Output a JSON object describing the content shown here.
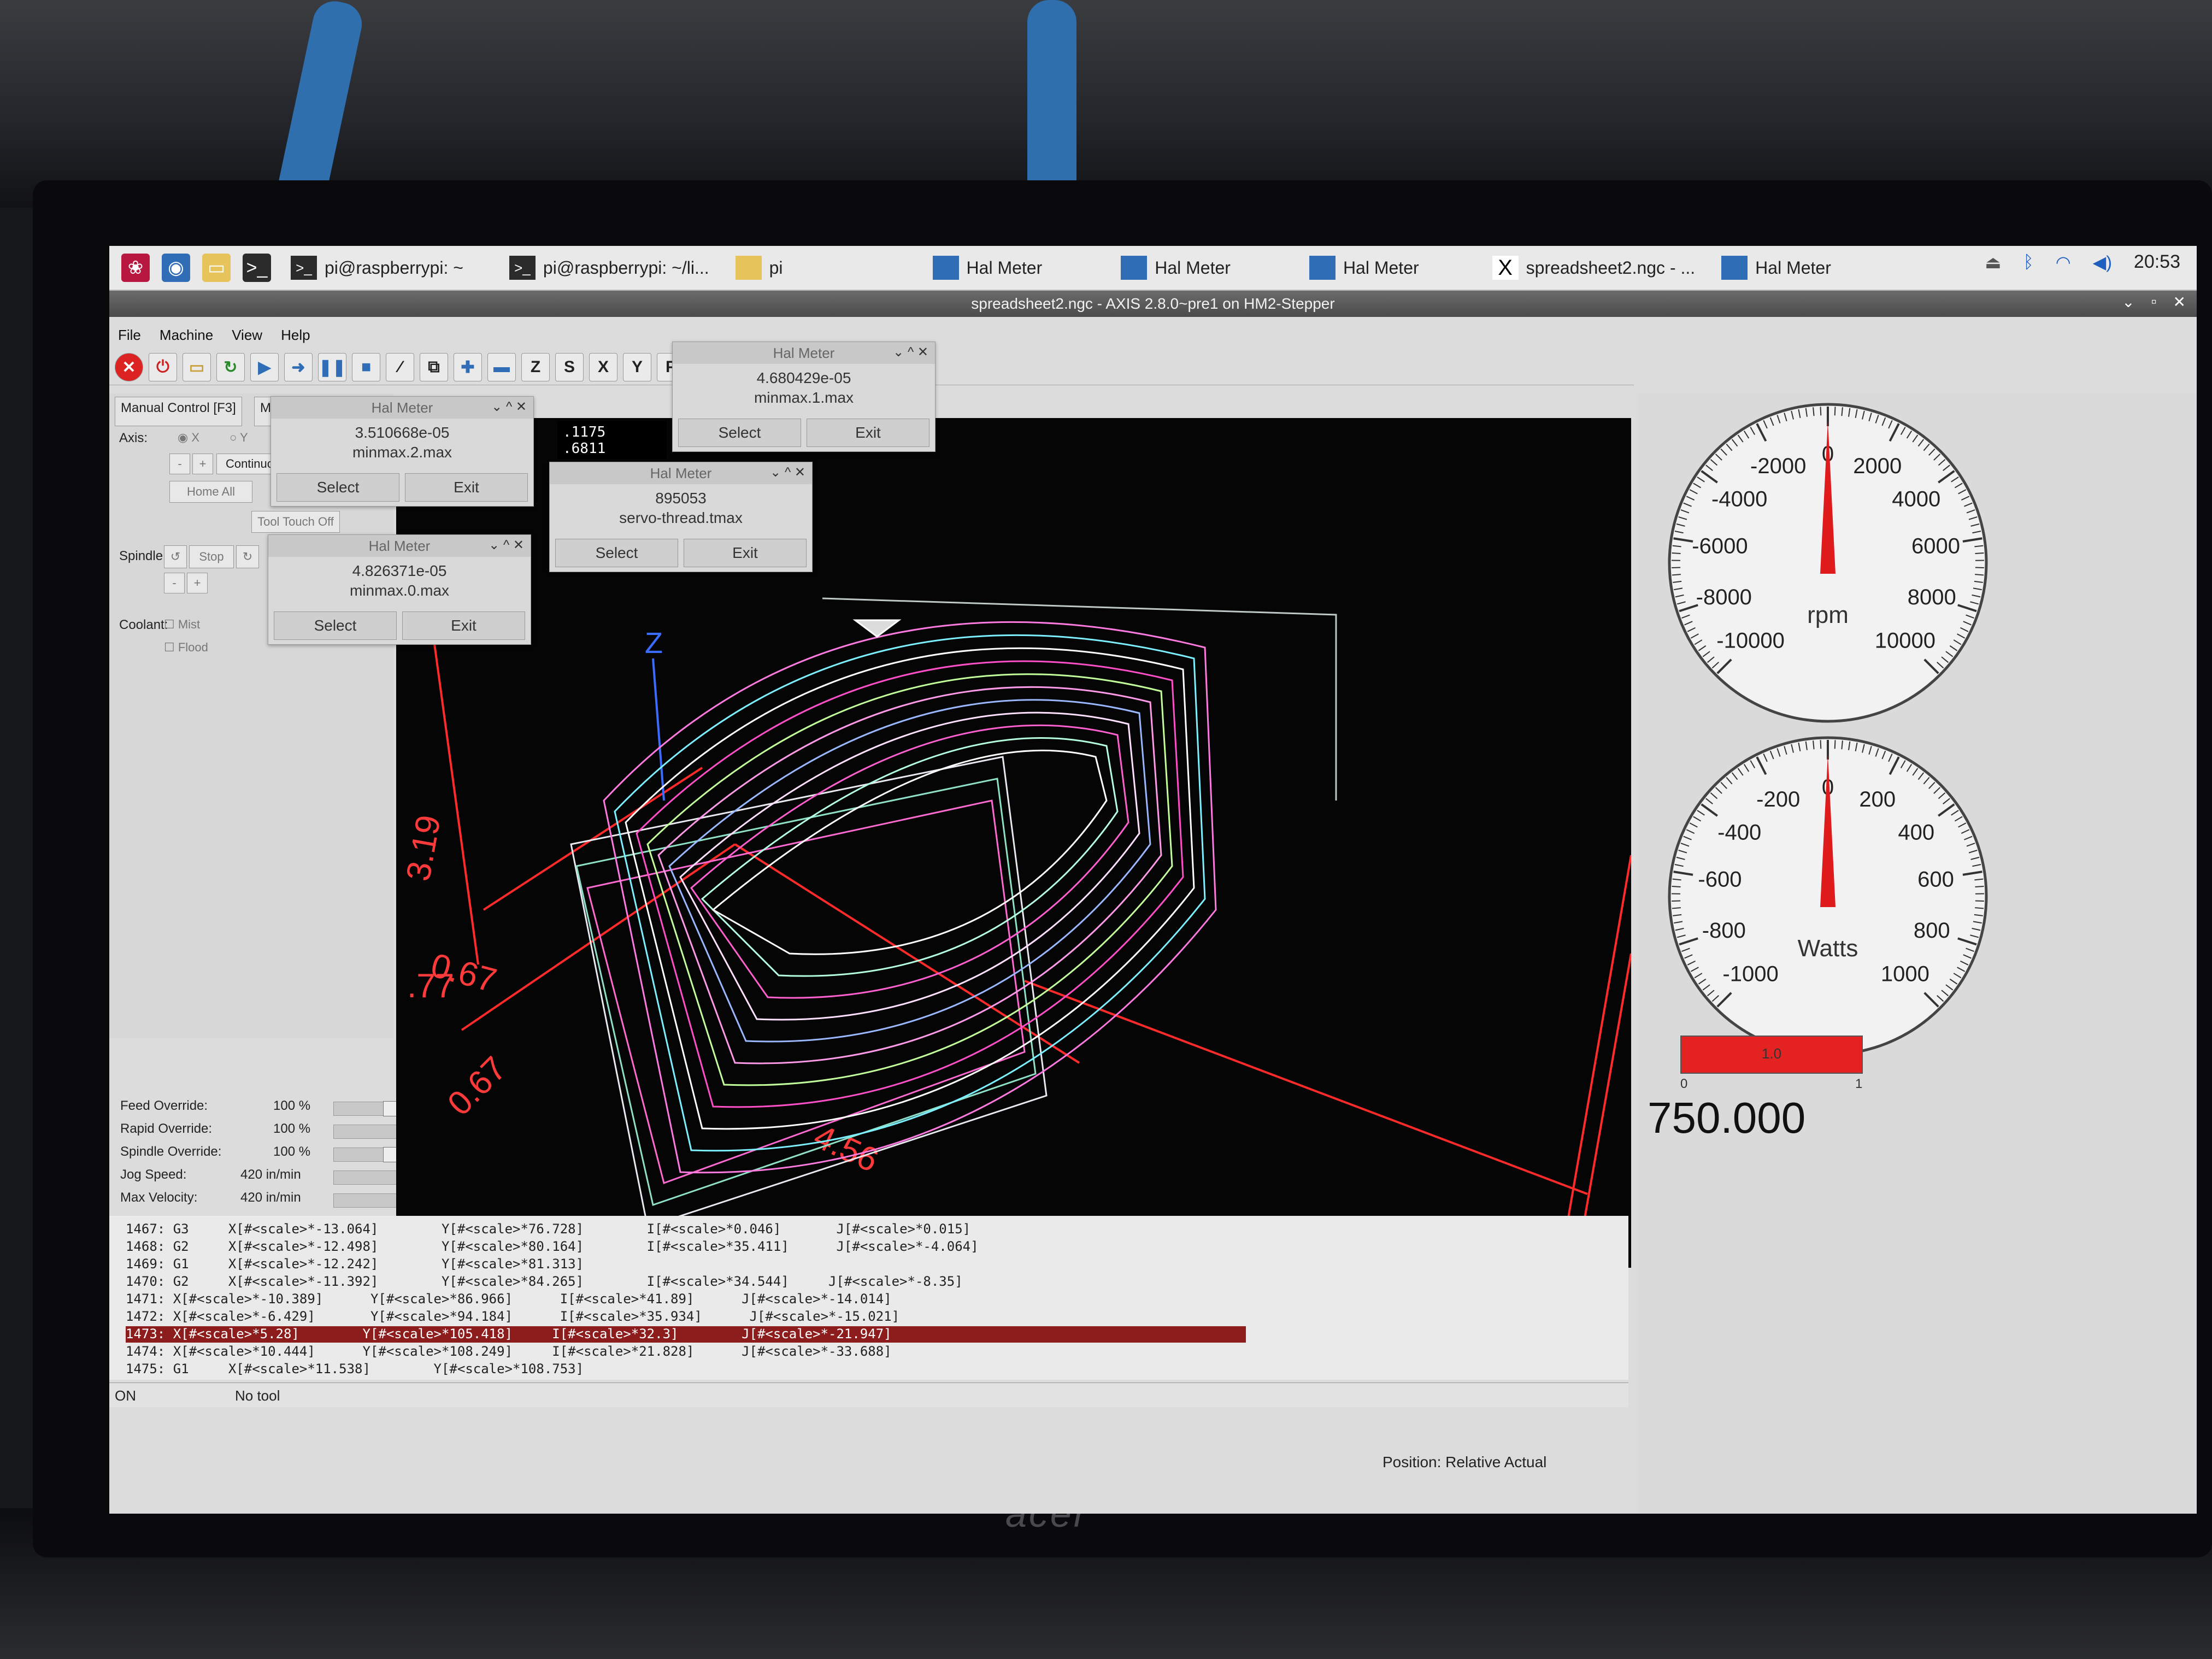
{
  "taskbar": {
    "tasks": [
      {
        "label": "pi@raspberrypi: ~"
      },
      {
        "label": "pi@raspberrypi: ~/li..."
      },
      {
        "label": "pi"
      },
      {
        "label": "Hal Meter"
      },
      {
        "label": "Hal Meter"
      },
      {
        "label": "Hal Meter"
      },
      {
        "label": "spreadsheet2.ngc - ..."
      },
      {
        "label": "Hal Meter"
      }
    ],
    "clock": "20:53"
  },
  "window": {
    "title": "spreadsheet2.ngc - AXIS 2.8.0~pre1 on HM2-Stepper"
  },
  "menu": [
    "File",
    "Machine",
    "View",
    "Help"
  ],
  "toolbar": {
    "letters": [
      "Z",
      "S",
      "X",
      "Y",
      "P"
    ]
  },
  "left_panel": {
    "tabs": [
      "Manual Control [F3]",
      "MDI"
    ],
    "axis_label": "Axis:",
    "axis_x": "X",
    "axis_y": "Y",
    "continuous": "Continuo",
    "home_all": "Home All",
    "tool_touch_off": "Tool Touch Off",
    "spindle_label": "Spindle:",
    "stop": "Stop",
    "coolant_label": "Coolant:",
    "mist": "Mist",
    "flood": "Flood"
  },
  "readout": {
    "line1": ".1175",
    "line2": ".6811"
  },
  "overrides": [
    {
      "label": "Feed Override:",
      "value": "100 %"
    },
    {
      "label": "Rapid Override:",
      "value": "100 %"
    },
    {
      "label": "Spindle Override:",
      "value": "100 %"
    },
    {
      "label": "Jog Speed:",
      "value": "420 in/min"
    },
    {
      "label": "Max Velocity:",
      "value": "420 in/min"
    }
  ],
  "hal_meters": [
    {
      "title": "Hal Meter",
      "value": "4.680429e-05",
      "pin": "minmax.1.max",
      "select": "Select",
      "exit": "Exit"
    },
    {
      "title": "Hal Meter",
      "value": "3.510668e-05",
      "pin": "minmax.2.max",
      "select": "Select",
      "exit": "Exit"
    },
    {
      "title": "Hal Meter",
      "value": "895053",
      "pin": "servo-thread.tmax",
      "select": "Select",
      "exit": "Exit"
    },
    {
      "title": "Hal Meter",
      "value": "4.826371e-05",
      "pin": "minmax.0.max",
      "select": "Select",
      "exit": "Exit"
    }
  ],
  "viewport": {
    "dims": [
      "3.19",
      "0.67",
      "0.67",
      "4.56",
      ".77"
    ],
    "axis_z": "Z"
  },
  "gcode": [
    {
      "n": "1467: G3",
      "x": "X[#<scale>*-13.064]",
      "y": "Y[#<scale>*76.728]",
      "i": "I[#<scale>*0.046]",
      "j": "J[#<scale>*0.015]",
      "hl": false
    },
    {
      "n": "1468: G2",
      "x": "X[#<scale>*-12.498]",
      "y": "Y[#<scale>*80.164]",
      "i": "I[#<scale>*35.411]",
      "j": "J[#<scale>*-4.064]",
      "hl": false
    },
    {
      "n": "1469: G1",
      "x": "X[#<scale>*-12.242]",
      "y": "Y[#<scale>*81.313]",
      "i": "",
      "j": "",
      "hl": false
    },
    {
      "n": "1470: G2",
      "x": "X[#<scale>*-11.392]",
      "y": "Y[#<scale>*84.265]",
      "i": "I[#<scale>*34.544]",
      "j": "J[#<scale>*-8.35]",
      "hl": false
    },
    {
      "n": "1471: X[#<scale>*-10.389]",
      "x": "",
      "y": "Y[#<scale>*86.966]",
      "i": "I[#<scale>*41.89]",
      "j": "J[#<scale>*-14.014]",
      "hl": false
    },
    {
      "n": "1472: X[#<scale>*-6.429]",
      "x": "",
      "y": "Y[#<scale>*94.184]",
      "i": "I[#<scale>*35.934]",
      "j": "J[#<scale>*-15.021]",
      "hl": false
    },
    {
      "n": "1473: X[#<scale>*5.28]",
      "x": "",
      "y": "Y[#<scale>*105.418]",
      "i": "I[#<scale>*32.3]",
      "j": "J[#<scale>*-21.947]",
      "hl": true
    },
    {
      "n": "1474: X[#<scale>*10.444]",
      "x": "",
      "y": "Y[#<scale>*108.249]",
      "i": "I[#<scale>*21.828]",
      "j": "J[#<scale>*-33.688]",
      "hl": false
    },
    {
      "n": "1475: G1",
      "x": "X[#<scale>*11.538]",
      "y": "Y[#<scale>*108.753]",
      "i": "",
      "j": "",
      "hl": false
    }
  ],
  "status": {
    "state": "ON",
    "tool": "No tool",
    "position": "Position: Relative Actual"
  },
  "gauges": [
    {
      "unit": "rpm",
      "ticks": [
        "-10000",
        "-8000",
        "-6000",
        "-4000",
        "-2000",
        "0",
        "2000",
        "4000",
        "6000",
        "8000",
        "10000"
      ],
      "value": 0
    },
    {
      "unit": "Watts",
      "ticks": [
        "-1000",
        "-800",
        "-600",
        "-400",
        "-200",
        "0",
        "200",
        "400",
        "600",
        "800",
        "1000"
      ],
      "value": 0
    }
  ],
  "bar": {
    "label": "1.0",
    "min": "0",
    "max": "1",
    "fraction": 1.0
  },
  "big_number": "750.000",
  "colors": {
    "highlight": "#8d1c1c",
    "needle": "#e01b1b",
    "bar": "#e52222"
  }
}
